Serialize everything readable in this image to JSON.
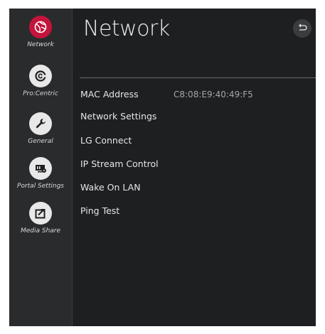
{
  "sidebar": {
    "items": [
      {
        "label": "Network",
        "icon": "globe-icon",
        "active": true
      },
      {
        "label": "Pro:Centric",
        "icon": "procentric-icon",
        "active": false
      },
      {
        "label": "General",
        "icon": "wrench-icon",
        "active": false
      },
      {
        "label": "Portal Settings",
        "icon": "portal-settings-icon",
        "active": false
      },
      {
        "label": "Media Share",
        "icon": "media-share-icon",
        "active": false
      }
    ]
  },
  "header": {
    "title": "Network",
    "back_icon": "back-arrow-icon"
  },
  "menu": {
    "mac_label": "MAC Address",
    "mac_value": "C8:08:E9:40:49:F5",
    "network_settings": "Network Settings",
    "lg_connect": "LG Connect",
    "ip_stream_control": "IP Stream Control",
    "wake_on_lan": "Wake On LAN",
    "ping_test": "Ping Test"
  },
  "colors": {
    "accent": "#c4143c",
    "background": "#1e1f21",
    "sidebar": "#2a2b2d"
  }
}
